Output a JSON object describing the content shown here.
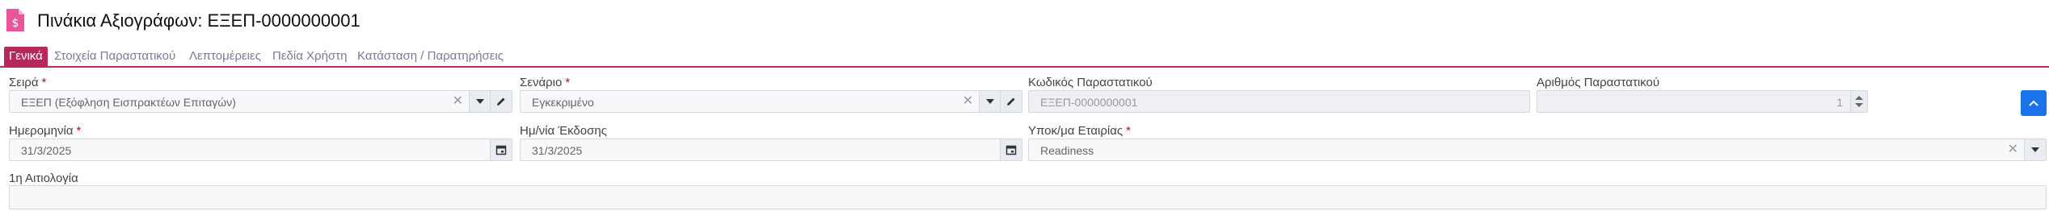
{
  "header": {
    "title": "Πινάκια Αξιογράφων: ΕΞΕΠ-0000000001",
    "icon": "document-dollar-icon",
    "icon_color": "#e8559b"
  },
  "tabs": [
    {
      "label": "Γενικά",
      "active": true
    },
    {
      "label": "Στοιχεία Παραστατικού",
      "active": false
    },
    {
      "label": "Λεπτομέρειες",
      "active": false
    },
    {
      "label": "Πεδία Χρήστη",
      "active": false
    },
    {
      "label": "Κατάσταση / Παρατηρήσεις",
      "active": false
    }
  ],
  "form": {
    "series": {
      "label": "Σειρά",
      "required": "*",
      "value": "ΕΞΕΠ (Εξόφληση Εισπρακτέων Επιταγών)"
    },
    "scenario": {
      "label": "Σενάριο",
      "required": "*",
      "value": "Εγκεκριμένο"
    },
    "doc_code": {
      "label": "Κωδικός Παραστατικού",
      "value": "ΕΞΕΠ-0000000001"
    },
    "doc_number": {
      "label": "Αριθμός Παραστατικού",
      "value": "1"
    },
    "date": {
      "label": "Ημερομηνία",
      "required": "*",
      "value": "31/3/2025"
    },
    "issue_date": {
      "label": "Ημ/νία Έκδοσης",
      "value": "31/3/2025"
    },
    "branch": {
      "label": "Υποκ/μα Εταιρίας",
      "required": "*",
      "value": "Readiness"
    },
    "reason": {
      "label": "1η Αιτιολογία",
      "value": ""
    }
  },
  "colors": {
    "accent": "#b7285c",
    "primary_button": "#1a73e8",
    "required": "#d0021b"
  },
  "icons": {
    "clear": "close-icon",
    "dropdown": "chevron-down-icon",
    "edit": "pencil-icon",
    "calendar": "calendar-icon",
    "scroll_top": "chevron-up-icon"
  }
}
